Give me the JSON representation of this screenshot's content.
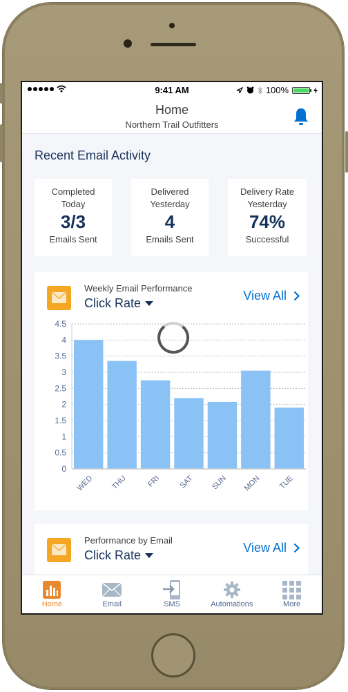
{
  "status_bar": {
    "time": "9:41 AM",
    "battery": "100%",
    "icons": [
      "signal-dots-icon",
      "wifi-icon",
      "location-icon",
      "alarm-icon",
      "bluetooth-icon",
      "battery-icon",
      "charging-icon"
    ]
  },
  "header": {
    "title": "Home",
    "subtitle": "Northern Trail Outfitters",
    "notification_icon": "bell-icon"
  },
  "recent_activity": {
    "title": "Recent Email Activity",
    "stats": [
      {
        "label_line1": "Completed",
        "label_line2": "Today",
        "value": "3/3",
        "sub": "Emails Sent"
      },
      {
        "label_line1": "Delivered",
        "label_line2": "Yesterday",
        "value": "4",
        "sub": "Emails Sent"
      },
      {
        "label_line1": "Delivery Rate",
        "label_line2": "Yesterday",
        "value": "74%",
        "sub": "Successful"
      }
    ]
  },
  "weekly_card": {
    "kicker": "Weekly Email Performance",
    "metric": "Click Rate",
    "view_all": "View All"
  },
  "performance_card": {
    "kicker": "Performance by Email",
    "metric": "Click Rate",
    "view_all": "View All"
  },
  "colors": {
    "accent": "#0070d2",
    "bar": "#8ac2f5",
    "card_icon": "#f5a623",
    "active_tab": "#e8882f",
    "heading": "#16325c"
  },
  "chart_data": {
    "type": "bar",
    "title": "Weekly Email Performance - Click Rate",
    "categories": [
      "WED",
      "THU",
      "FRI",
      "SAT",
      "SUN",
      "MON",
      "TUE"
    ],
    "values": [
      4.0,
      3.35,
      2.75,
      2.2,
      2.08,
      3.05,
      1.9
    ],
    "xlabel": "",
    "ylabel": "",
    "ylim": [
      0,
      4.5
    ],
    "yticks": [
      "0",
      "0.5",
      "1",
      "1.5",
      "2",
      "2.5",
      "3",
      "3.5",
      "4",
      "4.5"
    ],
    "grid": true,
    "loading_spinner": true
  },
  "tab_bar": {
    "tabs": [
      {
        "label": "Home",
        "icon": "bar-chart-icon",
        "active": true
      },
      {
        "label": "Email",
        "icon": "envelope-icon",
        "active": false
      },
      {
        "label": "SMS",
        "icon": "phone-sms-icon",
        "active": false
      },
      {
        "label": "Automations",
        "icon": "gear-icon",
        "active": false
      },
      {
        "label": "More",
        "icon": "grid-icon",
        "active": false
      }
    ]
  }
}
